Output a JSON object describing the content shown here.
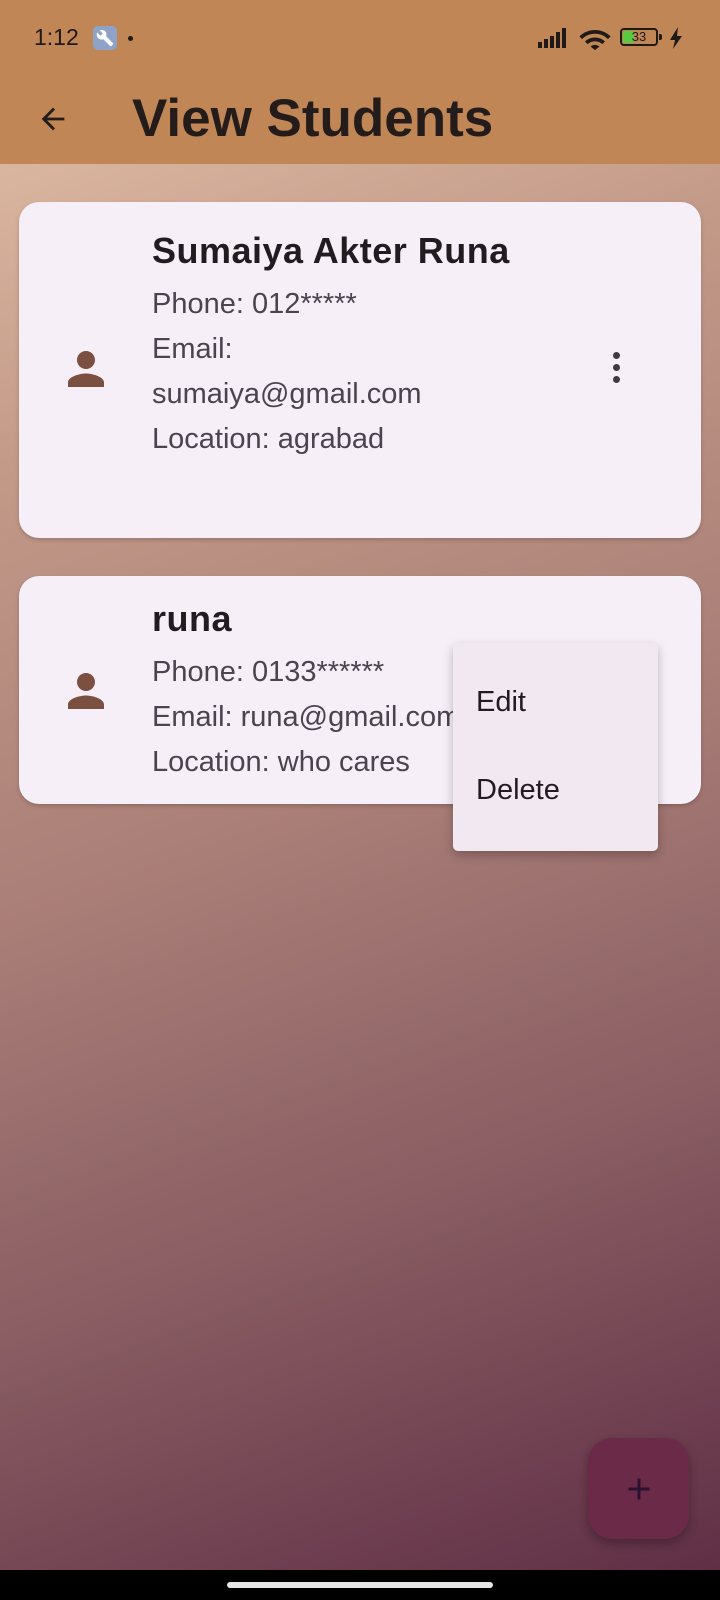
{
  "status_bar": {
    "time": "1:12",
    "battery": "33",
    "battery_level": 0.33,
    "icons": [
      "wrench-icon",
      "signal-icon",
      "wifi-icon",
      "battery-icon",
      "charging-icon"
    ]
  },
  "app_bar": {
    "title": "View Students",
    "back_icon": "arrow-back-icon"
  },
  "students": [
    {
      "name": "Sumaiya Akter Runa",
      "phone": "Phone: 012*****",
      "email_label": "Email:",
      "email": "sumaiya@gmail.com",
      "location": "Location: agrabad"
    },
    {
      "name": "runa",
      "phone": "Phone: 0133******",
      "email": "Email: runa@gmail.com",
      "location": "Location: who cares"
    }
  ],
  "popup_menu": {
    "items": [
      "Edit",
      "Delete"
    ]
  },
  "fab": {
    "icon": "add-icon"
  },
  "colors": {
    "app_bar": "#c08656",
    "card": "#f6eff7",
    "avatar": "#7b5040",
    "fab": "#6a2a48"
  }
}
